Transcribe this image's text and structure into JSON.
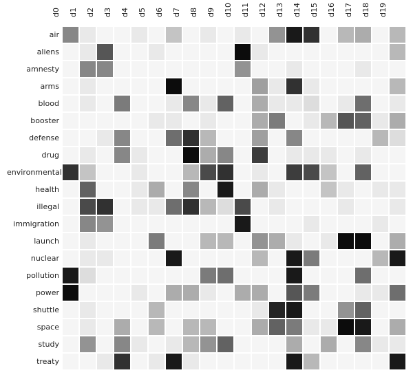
{
  "chart_data": {
    "type": "heatmap",
    "columns": [
      "d0",
      "d1",
      "d2",
      "d3",
      "d4",
      "d5",
      "d6",
      "d7",
      "d8",
      "d9",
      "d10",
      "d11",
      "d12",
      "d13",
      "d14",
      "d15",
      "d16",
      "d17",
      "d18",
      "d19"
    ],
    "rows": [
      "air",
      "aliens",
      "amnesty",
      "arms",
      "blood",
      "booster",
      "defense",
      "drug",
      "environmental",
      "health",
      "illegal",
      "immigration",
      "launch",
      "nuclear",
      "pollution",
      "power",
      "shuttle",
      "space",
      "study",
      "treaty"
    ],
    "values": [
      [
        0.45,
        0.05,
        0.0,
        0.0,
        0.05,
        0.0,
        0.2,
        0.0,
        0.05,
        0.0,
        0.05,
        0.0,
        0.4,
        0.9,
        0.8,
        0.0,
        0.25,
        0.3,
        0.0,
        0.25
      ],
      [
        0.0,
        0.05,
        0.65,
        0.0,
        0.0,
        0.05,
        0.0,
        0.0,
        0.0,
        0.0,
        0.95,
        0.05,
        0.0,
        0.0,
        0.0,
        0.0,
        0.0,
        0.0,
        0.0,
        0.25
      ],
      [
        0.0,
        0.45,
        0.45,
        0.0,
        0.0,
        0.0,
        0.0,
        0.0,
        0.0,
        0.0,
        0.4,
        0.0,
        0.0,
        0.05,
        0.0,
        0.0,
        0.0,
        0.05,
        0.0,
        0.0
      ],
      [
        0.0,
        0.05,
        0.0,
        0.0,
        0.0,
        0.0,
        0.95,
        0.0,
        0.0,
        0.0,
        0.0,
        0.35,
        0.05,
        0.8,
        0.05,
        0.0,
        0.0,
        0.0,
        0.0,
        0.25
      ],
      [
        0.0,
        0.05,
        0.0,
        0.5,
        0.0,
        0.0,
        0.05,
        0.45,
        0.05,
        0.6,
        0.0,
        0.3,
        0.05,
        0.05,
        0.1,
        0.0,
        0.05,
        0.55,
        0.0,
        0.05
      ],
      [
        0.0,
        0.0,
        0.0,
        0.0,
        0.0,
        0.05,
        0.05,
        0.0,
        0.05,
        0.0,
        0.0,
        0.3,
        0.5,
        0.0,
        0.05,
        0.25,
        0.65,
        0.6,
        0.05,
        0.3
      ],
      [
        0.0,
        0.0,
        0.05,
        0.45,
        0.0,
        0.0,
        0.55,
        0.8,
        0.25,
        0.0,
        0.0,
        0.35,
        0.0,
        0.45,
        0.0,
        0.0,
        0.0,
        0.0,
        0.25,
        0.1
      ],
      [
        0.0,
        0.05,
        0.0,
        0.45,
        0.05,
        0.0,
        0.0,
        0.95,
        0.3,
        0.45,
        0.0,
        0.75,
        0.0,
        0.05,
        0.05,
        0.05,
        0.0,
        0.05,
        0.0,
        0.0
      ],
      [
        0.8,
        0.2,
        0.0,
        0.0,
        0.05,
        0.0,
        0.0,
        0.25,
        0.7,
        0.8,
        0.0,
        0.05,
        0.0,
        0.75,
        0.7,
        0.2,
        0.0,
        0.6,
        0.0,
        0.0
      ],
      [
        0.0,
        0.6,
        0.0,
        0.0,
        0.05,
        0.3,
        0.0,
        0.45,
        0.0,
        0.9,
        0.0,
        0.3,
        0.05,
        0.0,
        0.0,
        0.2,
        0.05,
        0.0,
        0.05,
        0.05
      ],
      [
        0.0,
        0.7,
        0.8,
        0.0,
        0.05,
        0.05,
        0.55,
        0.8,
        0.25,
        0.1,
        0.7,
        0.0,
        0.05,
        0.0,
        0.0,
        0.0,
        0.05,
        0.0,
        0.0,
        0.05
      ],
      [
        0.0,
        0.45,
        0.4,
        0.0,
        0.0,
        0.0,
        0.0,
        0.0,
        0.0,
        0.0,
        0.9,
        0.0,
        0.0,
        0.0,
        0.05,
        0.0,
        0.0,
        0.0,
        0.05,
        0.0
      ],
      [
        0.0,
        0.05,
        0.0,
        0.0,
        0.0,
        0.5,
        0.0,
        0.0,
        0.25,
        0.25,
        0.0,
        0.4,
        0.3,
        0.05,
        0.0,
        0.05,
        0.95,
        0.95,
        0.0,
        0.3
      ],
      [
        0.0,
        0.05,
        0.05,
        0.0,
        0.0,
        0.0,
        0.9,
        0.0,
        0.0,
        0.0,
        0.0,
        0.25,
        0.0,
        0.9,
        0.5,
        0.0,
        0.0,
        0.0,
        0.25,
        0.9
      ],
      [
        0.9,
        0.1,
        0.0,
        0.0,
        0.0,
        0.0,
        0.0,
        0.0,
        0.5,
        0.55,
        0.0,
        0.0,
        0.0,
        0.9,
        0.0,
        0.0,
        0.0,
        0.55,
        0.0,
        0.0
      ],
      [
        0.95,
        0.0,
        0.0,
        0.0,
        0.05,
        0.0,
        0.3,
        0.3,
        0.05,
        0.0,
        0.3,
        0.3,
        0.0,
        0.65,
        0.5,
        0.0,
        0.0,
        0.05,
        0.05,
        0.55
      ],
      [
        0.0,
        0.05,
        0.0,
        0.0,
        0.0,
        0.25,
        0.0,
        0.0,
        0.0,
        0.0,
        0.0,
        0.05,
        0.85,
        0.9,
        0.0,
        0.0,
        0.4,
        0.6,
        0.0,
        0.0
      ],
      [
        0.0,
        0.05,
        0.0,
        0.3,
        0.0,
        0.25,
        0.0,
        0.25,
        0.25,
        0.0,
        0.0,
        0.3,
        0.6,
        0.5,
        0.05,
        0.05,
        0.95,
        0.9,
        0.0,
        0.3
      ],
      [
        0.0,
        0.4,
        0.0,
        0.45,
        0.05,
        0.0,
        0.05,
        0.25,
        0.4,
        0.6,
        0.0,
        0.0,
        0.0,
        0.3,
        0.0,
        0.3,
        0.0,
        0.45,
        0.05,
        0.05
      ],
      [
        0.0,
        0.0,
        0.05,
        0.8,
        0.0,
        0.05,
        0.9,
        0.05,
        0.0,
        0.0,
        0.0,
        0.0,
        0.0,
        0.9,
        0.25,
        0.0,
        0.0,
        0.0,
        0.0,
        0.9
      ]
    ],
    "scale": {
      "min": 0.0,
      "max": 1.0,
      "low_color": "#f5f5f5",
      "high_color": "#000000"
    }
  }
}
